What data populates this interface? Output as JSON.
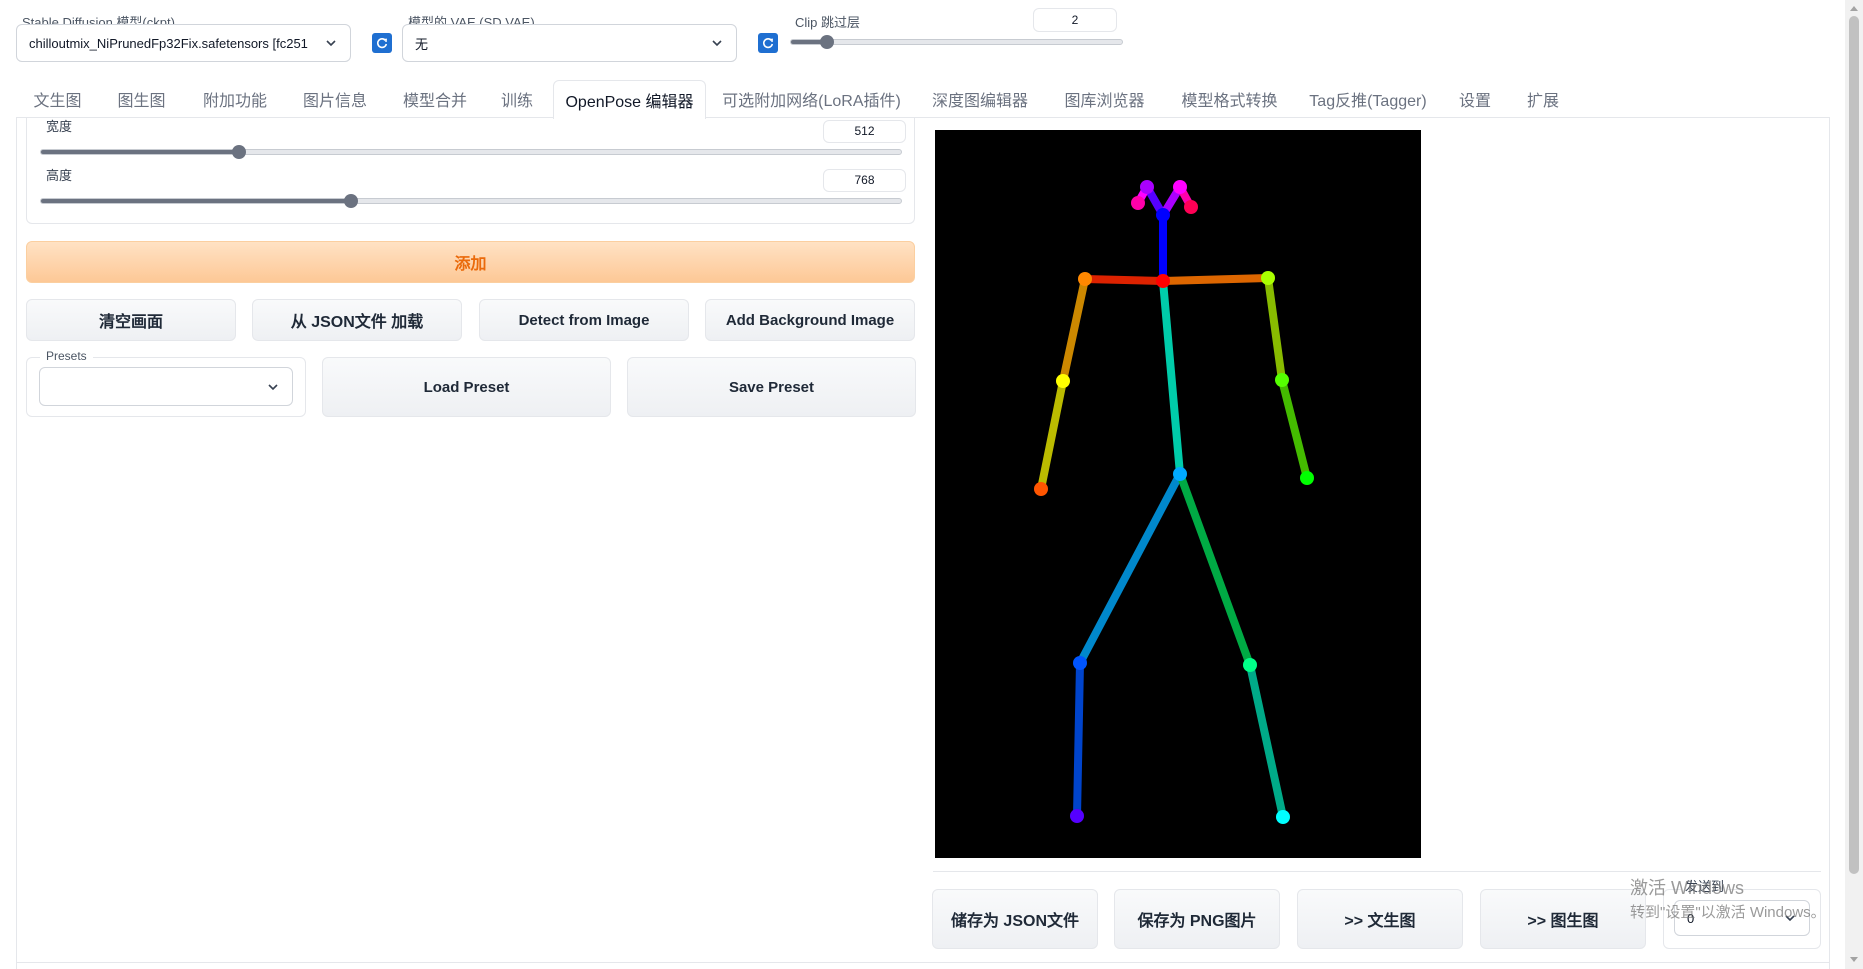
{
  "model": {
    "label": "Stable Diffusion 模型(ckpt)",
    "value": "chilloutmix_NiPrunedFp32Fix.safetensors [fc251"
  },
  "vae": {
    "label": "模型的 VAE (SD VAE)",
    "value": "无"
  },
  "clip": {
    "label": "Clip 跳过层",
    "value": "2",
    "level_fraction": 0.11
  },
  "tabs": [
    {
      "label": "文生图"
    },
    {
      "label": "图生图"
    },
    {
      "label": "附加功能"
    },
    {
      "label": "图片信息"
    },
    {
      "label": "模型合并"
    },
    {
      "label": "训练"
    },
    {
      "label": "OpenPose 编辑器"
    },
    {
      "label": "可选附加网络(LoRA插件)"
    },
    {
      "label": "深度图编辑器"
    },
    {
      "label": "图库浏览器"
    },
    {
      "label": "模型格式转换"
    },
    {
      "label": "Tag反推(Tagger)"
    },
    {
      "label": "设置"
    },
    {
      "label": "扩展"
    }
  ],
  "active_tab": "OpenPose 编辑器",
  "width": {
    "label": "宽度",
    "value": "512",
    "level_fraction": 0.23
  },
  "height": {
    "label": "高度",
    "value": "768",
    "level_fraction": 0.36
  },
  "buttons": {
    "add": "添加",
    "clear": "清空画面",
    "load_json": "从 JSON文件 加载",
    "detect": "Detect from Image",
    "add_bg": "Add Background Image",
    "load_preset": "Load Preset",
    "save_preset": "Save Preset",
    "save_json": "储存为 JSON文件",
    "save_png": "保存为 PNG图片",
    "to_txt2img": ">> 文生图",
    "to_img2img": ">> 图生图"
  },
  "presets": {
    "label": "Presets",
    "value": ""
  },
  "send_to": {
    "label": "发送到",
    "value": "0"
  },
  "watermark": {
    "line1": "激活 Windows",
    "line2": "转到\"设置\"以激活 Windows。"
  },
  "colors": {
    "accent_blue": "#1f6fd1",
    "orange_text": "#ea6a0b",
    "canvas_bg": "#000000"
  }
}
